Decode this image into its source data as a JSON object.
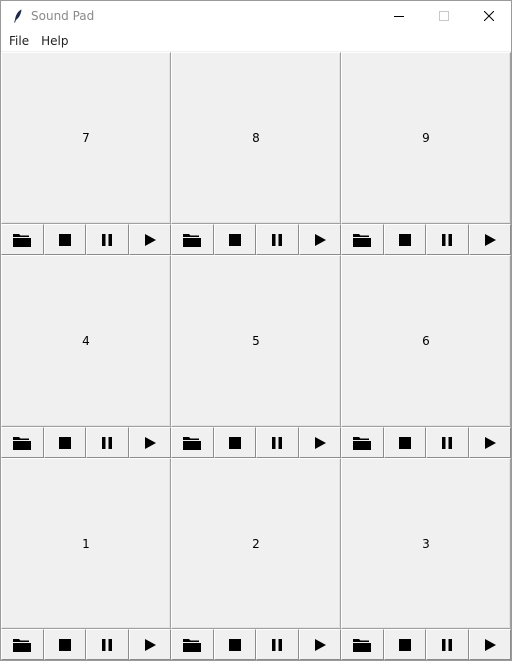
{
  "window": {
    "title": "Sound Pad",
    "controls": [
      "minimize",
      "maximize",
      "close"
    ]
  },
  "menu": {
    "file_label": "File",
    "help_label": "Help"
  },
  "pads": [
    {
      "label": "7"
    },
    {
      "label": "8"
    },
    {
      "label": "9"
    },
    {
      "label": "4"
    },
    {
      "label": "5"
    },
    {
      "label": "6"
    },
    {
      "label": "1"
    },
    {
      "label": "2"
    },
    {
      "label": "3"
    }
  ],
  "pad_controls": [
    "folder-icon",
    "stop-icon",
    "pause-icon",
    "play-icon"
  ],
  "colors": {
    "background": "#f0f0f0",
    "titlebar": "#ffffff",
    "title_text": "#8a8a8a",
    "icon": "#000000"
  }
}
